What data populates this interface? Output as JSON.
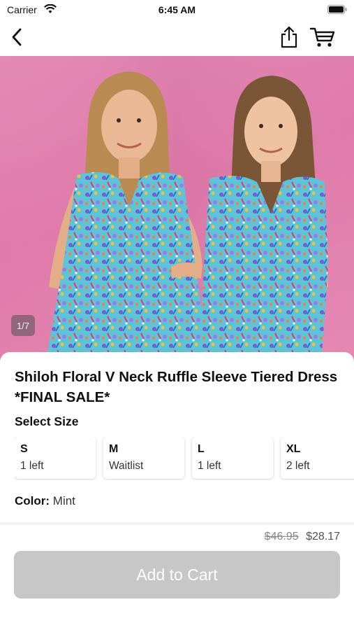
{
  "status_bar": {
    "carrier": "Carrier",
    "time": "6:45 AM"
  },
  "nav": {
    "back_icon": "chevron-left-icon",
    "share_icon": "share-icon",
    "cart_icon": "cart-icon"
  },
  "gallery": {
    "page_indicator": "1/7",
    "current_page": 1,
    "total_pages": 7
  },
  "product": {
    "title": "Shiloh Floral V Neck Ruffle Sleeve Tiered Dress *FINAL SALE*",
    "select_size_label": "Select Size",
    "sizes": [
      {
        "name": "S",
        "stock": "1 left"
      },
      {
        "name": "M",
        "stock": "Waitlist"
      },
      {
        "name": "L",
        "stock": "1 left"
      },
      {
        "name": "XL",
        "stock": "2 left"
      }
    ],
    "color_label": "Color:",
    "color_value": "Mint"
  },
  "pricing": {
    "original_price": "$46.95",
    "sale_price": "$28.17"
  },
  "cta": {
    "add_to_cart_label": "Add to Cart"
  },
  "colors": {
    "hero_background": "#e58ab5",
    "button_disabled": "#c7c7c7"
  }
}
